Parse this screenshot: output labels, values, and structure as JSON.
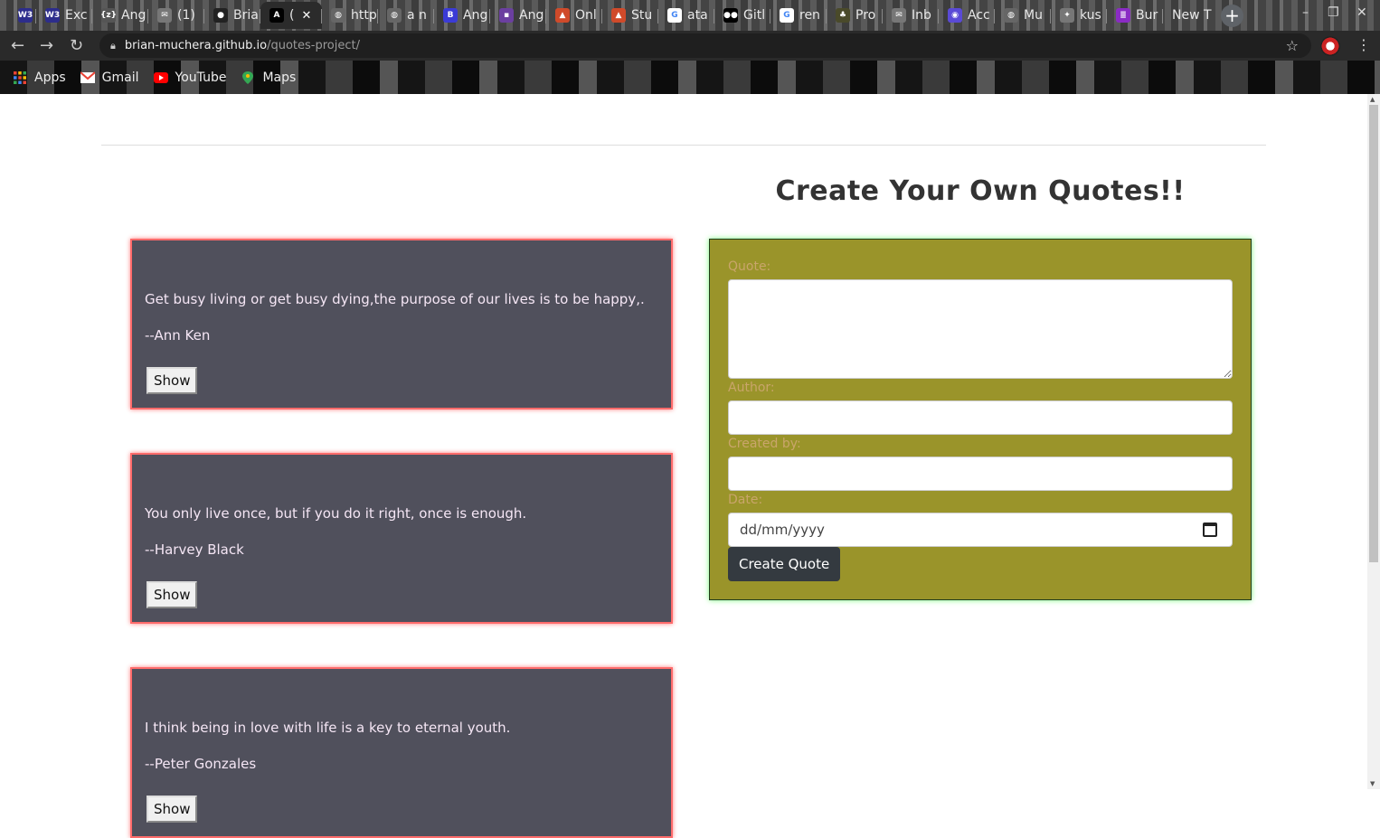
{
  "browser": {
    "tabs": [
      {
        "label": "",
        "fav": "W3",
        "color": "#2d2d8c"
      },
      {
        "label": "Exc",
        "fav": "W3",
        "color": "#2d2d8c"
      },
      {
        "label": "Ang",
        "fav": "{z}",
        "color": "#555"
      },
      {
        "label": "(1) ",
        "fav": "✉",
        "color": "#777"
      },
      {
        "label": "Bria",
        "fav": "●",
        "color": "#222"
      },
      {
        "label": "(",
        "fav": "A",
        "color": "#000"
      },
      {
        "label": "http",
        "fav": "◍",
        "color": "#666"
      },
      {
        "label": "a n",
        "fav": "◍",
        "color": "#666"
      },
      {
        "label": "Ang",
        "fav": "B",
        "color": "#3b3bd6"
      },
      {
        "label": "Ang",
        "fav": "▪",
        "color": "#6b3fa0"
      },
      {
        "label": "Onl",
        "fav": "▲",
        "color": "#d04a2a"
      },
      {
        "label": "Stu",
        "fav": "▲",
        "color": "#d04a2a"
      },
      {
        "label": "ata",
        "fav": "G",
        "color": "#fff"
      },
      {
        "label": "Gitl",
        "fav": "●●",
        "color": "#000"
      },
      {
        "label": "ren",
        "fav": "G",
        "color": "#fff"
      },
      {
        "label": "Pro",
        "fav": "♣",
        "color": "#4a4a2a"
      },
      {
        "label": "Inb",
        "fav": "✉",
        "color": "#777"
      },
      {
        "label": "Acc",
        "fav": "◉",
        "color": "#5a4ad6"
      },
      {
        "label": "Mu",
        "fav": "◍",
        "color": "#666"
      },
      {
        "label": "kus",
        "fav": "✦",
        "color": "#777"
      },
      {
        "label": "Bur",
        "fav": "≣",
        "color": "#8a2bc4"
      },
      {
        "label": "New T",
        "fav": "",
        "color": "transparent"
      }
    ],
    "url_host": "brian-muchera.github.io",
    "url_path": "/quotes-project/",
    "bookmarks": [
      {
        "label": "Apps",
        "icon": "apps-grid-icon"
      },
      {
        "label": "Gmail",
        "icon": "gmail-icon"
      },
      {
        "label": "YouTube",
        "icon": "youtube-icon"
      },
      {
        "label": "Maps",
        "icon": "maps-icon"
      }
    ]
  },
  "page": {
    "title": "Create Your Own Quotes!!",
    "quotes": [
      {
        "text": "Get busy living or get busy dying,the purpose of our lives is to be happy,.",
        "author": "--Ann Ken",
        "button": "Show"
      },
      {
        "text": "You only live once, but if you do it right, once is enough.",
        "author": "--Harvey Black",
        "button": "Show"
      },
      {
        "text": "I think being in love with life is a key to eternal youth.",
        "author": "--Peter Gonzales",
        "button": "Show"
      }
    ],
    "form": {
      "quote_label": "Quote:",
      "author_label": "Author:",
      "created_label": "Created by:",
      "date_label": "Date:",
      "date_placeholder": "dd/mm/yyyy",
      "submit_label": "Create Quote"
    }
  },
  "colors": {
    "card_bg": "#50505c",
    "card_border": "#ff6b6b",
    "form_bg": "#9a942a",
    "button_dark": "#343a40"
  }
}
